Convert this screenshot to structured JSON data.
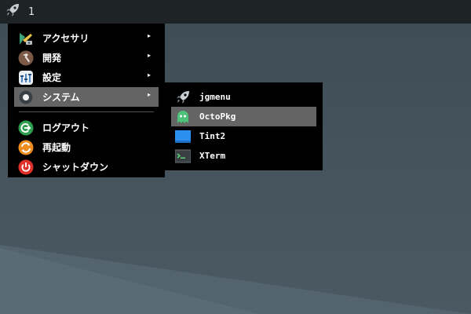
{
  "panel": {
    "launcher_icon": "rocket-icon",
    "workspace": "1"
  },
  "main_menu": {
    "items": [
      {
        "label": "アクセサリ",
        "icon": "accessories-icon",
        "submenu": true
      },
      {
        "label": "開発",
        "icon": "hammer-icon",
        "submenu": true
      },
      {
        "label": "設定",
        "icon": "settings-icon",
        "submenu": true
      },
      {
        "label": "システム",
        "icon": "system-icon",
        "submenu": true,
        "active": true
      },
      {
        "label": "ログアウト",
        "icon": "logout-icon"
      },
      {
        "label": "再起動",
        "icon": "reboot-icon"
      },
      {
        "label": "シャットダウン",
        "icon": "power-icon"
      }
    ],
    "arrow": "▸"
  },
  "system_submenu": {
    "items": [
      {
        "label": "jgmenu",
        "icon": "rocket-icon"
      },
      {
        "label": "OctoPkg",
        "icon": "octopkg-icon",
        "active": true
      },
      {
        "label": "Tint2",
        "icon": "tint2-icon"
      },
      {
        "label": "XTerm",
        "icon": "terminal-icon"
      }
    ]
  },
  "colors": {
    "panel_bg": "#1e2326",
    "menu_bg": "#000000",
    "highlight": "#646464",
    "desktop": "#45545d",
    "logout_green": "#2e9e4f",
    "reboot_orange": "#f08c1e",
    "power_red": "#e0302a",
    "octopkg_green": "#4ec27a",
    "tint2_blue": "#2b8ff0"
  }
}
